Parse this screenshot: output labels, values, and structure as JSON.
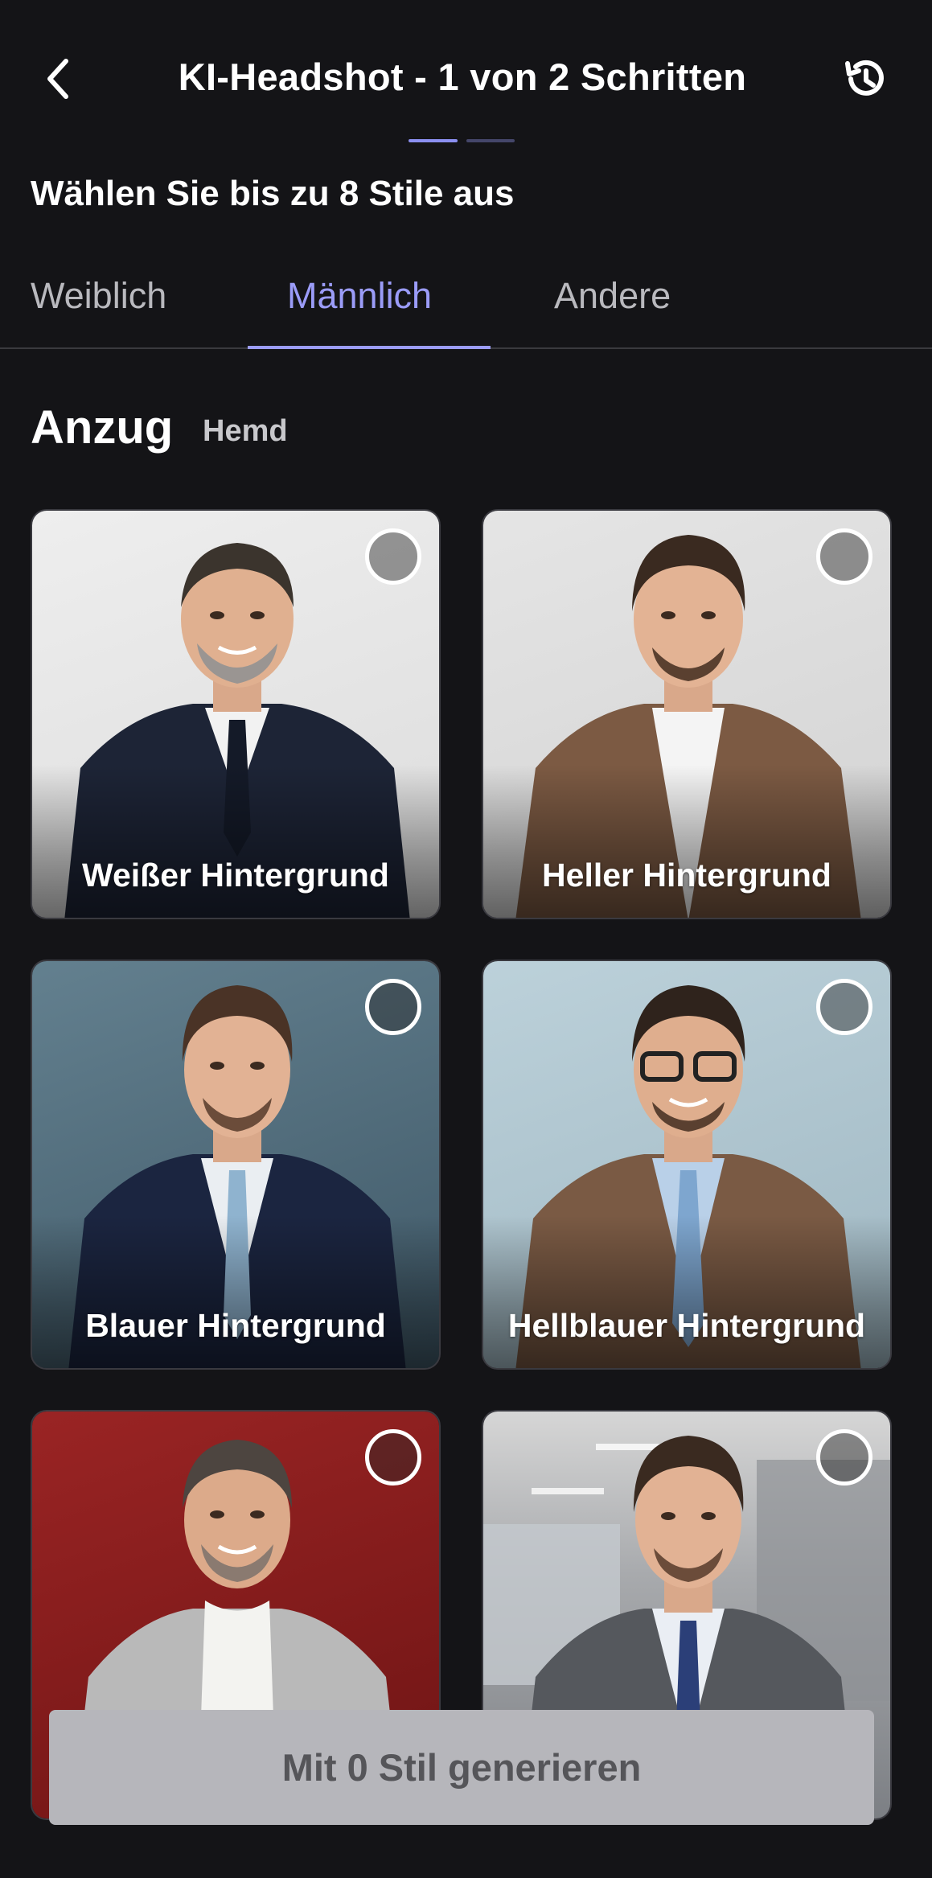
{
  "header": {
    "title": "KI-Headshot - 1 von 2 Schritten",
    "back_icon": "chevron-left-icon",
    "history_icon": "history-icon",
    "step_current": 1,
    "step_total": 2,
    "accent": "#8b8ff0"
  },
  "subtitle": "Wählen Sie bis zu 8 Stile aus",
  "tabs": [
    {
      "label": "Weiblich",
      "active": false
    },
    {
      "label": "Männlich",
      "active": true
    },
    {
      "label": "Andere",
      "active": false
    }
  ],
  "section": {
    "title": "Anzug",
    "sub": "Hemd"
  },
  "styles": [
    {
      "label": "Weißer Hintergrund",
      "selected": false,
      "background": "#e8e8e8"
    },
    {
      "label": "Heller Hintergrund",
      "selected": false,
      "background": "#dedede"
    },
    {
      "label": "Blauer Hintergrund",
      "selected": false,
      "background": "#546f7e"
    },
    {
      "label": "Hellblauer Hintergrund",
      "selected": false,
      "background": "#b0c6d0"
    },
    {
      "label": "",
      "selected": false,
      "background": "#8a1e1e"
    },
    {
      "label": "",
      "selected": false,
      "background": "#9a9ca0"
    }
  ],
  "generate_button": {
    "label": "Mit 0 Stil generieren",
    "enabled": false
  }
}
